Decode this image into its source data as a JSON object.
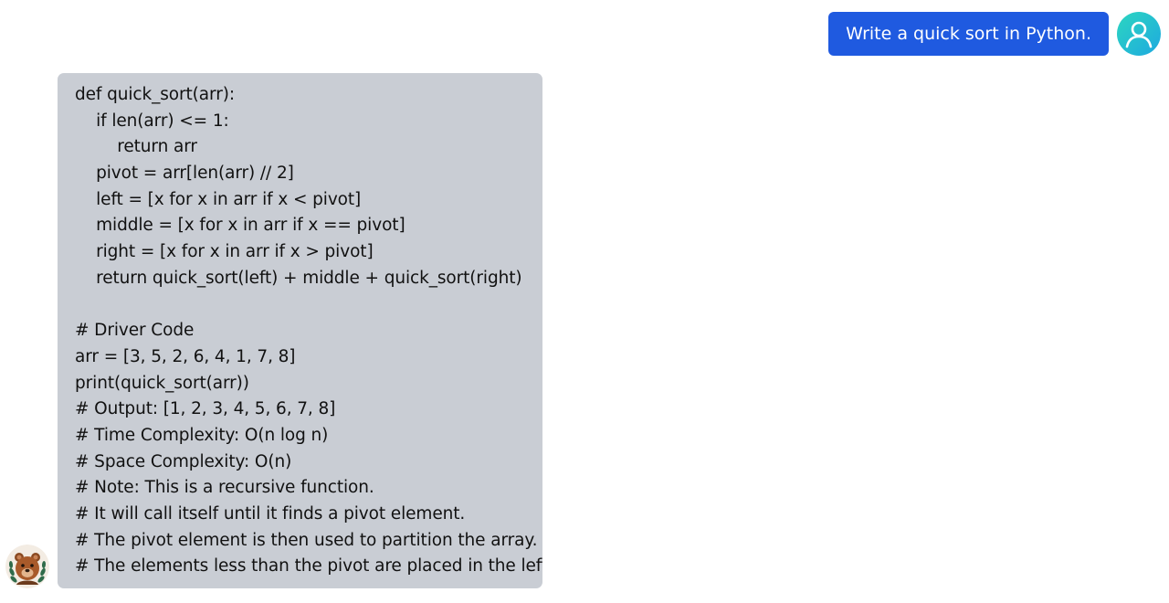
{
  "messages": {
    "user": {
      "text": "Write a quick sort in Python.",
      "avatar_icon": "user-icon",
      "bubble_color": "#1f5ae0"
    },
    "assistant": {
      "avatar_icon": "bear-avatar-icon",
      "bubble_color": "#c9cdd4",
      "lines": [
        "def quick_sort(arr):",
        "    if len(arr) <= 1:",
        "        return arr",
        "    pivot = arr[len(arr) // 2]",
        "    left = [x for x in arr if x < pivot]",
        "    middle = [x for x in arr if x == pivot]",
        "    right = [x for x in arr if x > pivot]",
        "    return quick_sort(left) + middle + quick_sort(right)",
        "",
        "# Driver Code",
        "arr = [3, 5, 2, 6, 4, 1, 7, 8]",
        "print(quick_sort(arr))",
        "# Output: [1, 2, 3, 4, 5, 6, 7, 8]",
        "# Time Complexity: O(n log n)",
        "# Space Complexity: O(n)",
        "# Note: This is a recursive function.",
        "# It will call itself until it finds a pivot element.",
        "# The pivot element is then used to partition the array.",
        "# The elements less than the pivot are placed in the left"
      ]
    }
  }
}
